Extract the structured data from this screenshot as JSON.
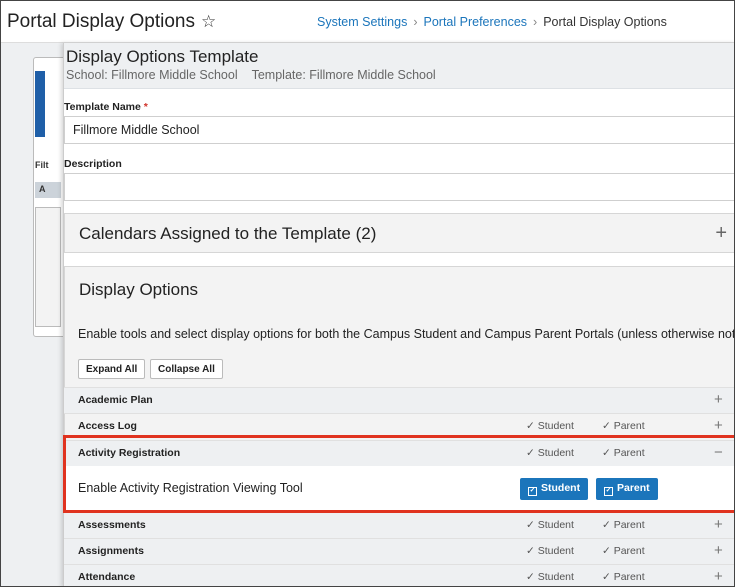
{
  "header": {
    "title": "Portal Display Options",
    "breadcrumb": [
      "System Settings",
      "Portal Preferences",
      "Portal Display Options"
    ]
  },
  "background": {
    "filter_label": "Filt",
    "tag": "A"
  },
  "modal": {
    "title": "Display Options Template",
    "school": "School: Fillmore Middle School",
    "template": "Template: Fillmore Middle School",
    "template_name_label": "Template Name",
    "required_mark": "*",
    "template_name_value": "Fillmore Middle School",
    "description_label": "Description",
    "description_value": "",
    "calendars_title": "Calendars Assigned to the Template (2)",
    "display_options_title": "Display Options",
    "display_options_desc": "Enable tools and select display options for both the Campus Student and Campus Parent Portals (unless otherwise noted).",
    "expand_all": "Expand All",
    "collapse_all": "Collapse All",
    "options": [
      {
        "name": "Academic Plan",
        "student": "",
        "parent": "",
        "sign": "+"
      },
      {
        "name": "Access Log",
        "student": "✓ Student",
        "parent": "✓ Parent",
        "sign": "+"
      },
      {
        "name": "Activity Registration",
        "student": "✓ Student",
        "parent": "✓ Parent",
        "sign": "−"
      },
      {
        "name": "Assessments",
        "student": "✓ Student",
        "parent": "✓ Parent",
        "sign": "+"
      },
      {
        "name": "Assignments",
        "student": "✓ Student",
        "parent": "✓ Parent",
        "sign": "+"
      },
      {
        "name": "Attendance",
        "student": "✓ Student",
        "parent": "✓ Parent",
        "sign": "+"
      }
    ],
    "activity_sub": {
      "label": "Enable Activity Registration Viewing Tool",
      "student_btn": "Student",
      "parent_btn": "Parent"
    }
  },
  "colors": {
    "accent": "#1b75bb",
    "highlight": "#e0331f",
    "required": "#d1332b"
  }
}
